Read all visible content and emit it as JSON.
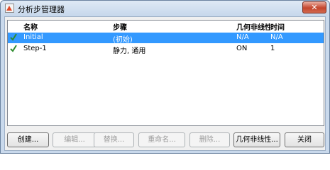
{
  "window": {
    "title": "分析步管理器",
    "close_label": "✕"
  },
  "table": {
    "columns": [
      "名称",
      "步骤",
      "几何非线性",
      "时间"
    ],
    "rows": [
      {
        "check": "✔",
        "name": "Initial",
        "procedure": "(初始)",
        "nlgeom": "N/A",
        "time": "N/A",
        "selected": true
      },
      {
        "check": "✔",
        "name": "Step-1",
        "procedure": "静力, 通用",
        "nlgeom": "ON",
        "time": "1",
        "selected": false
      }
    ]
  },
  "buttons": {
    "create": "创建...",
    "edit": "编辑...",
    "replace": "替换...",
    "rename": "重命名...",
    "delete": "删除...",
    "nlgeom": "几何非线性...",
    "close": "关闭"
  },
  "colors": {
    "selection": "#3399ff",
    "check": "#2e8b2e"
  }
}
